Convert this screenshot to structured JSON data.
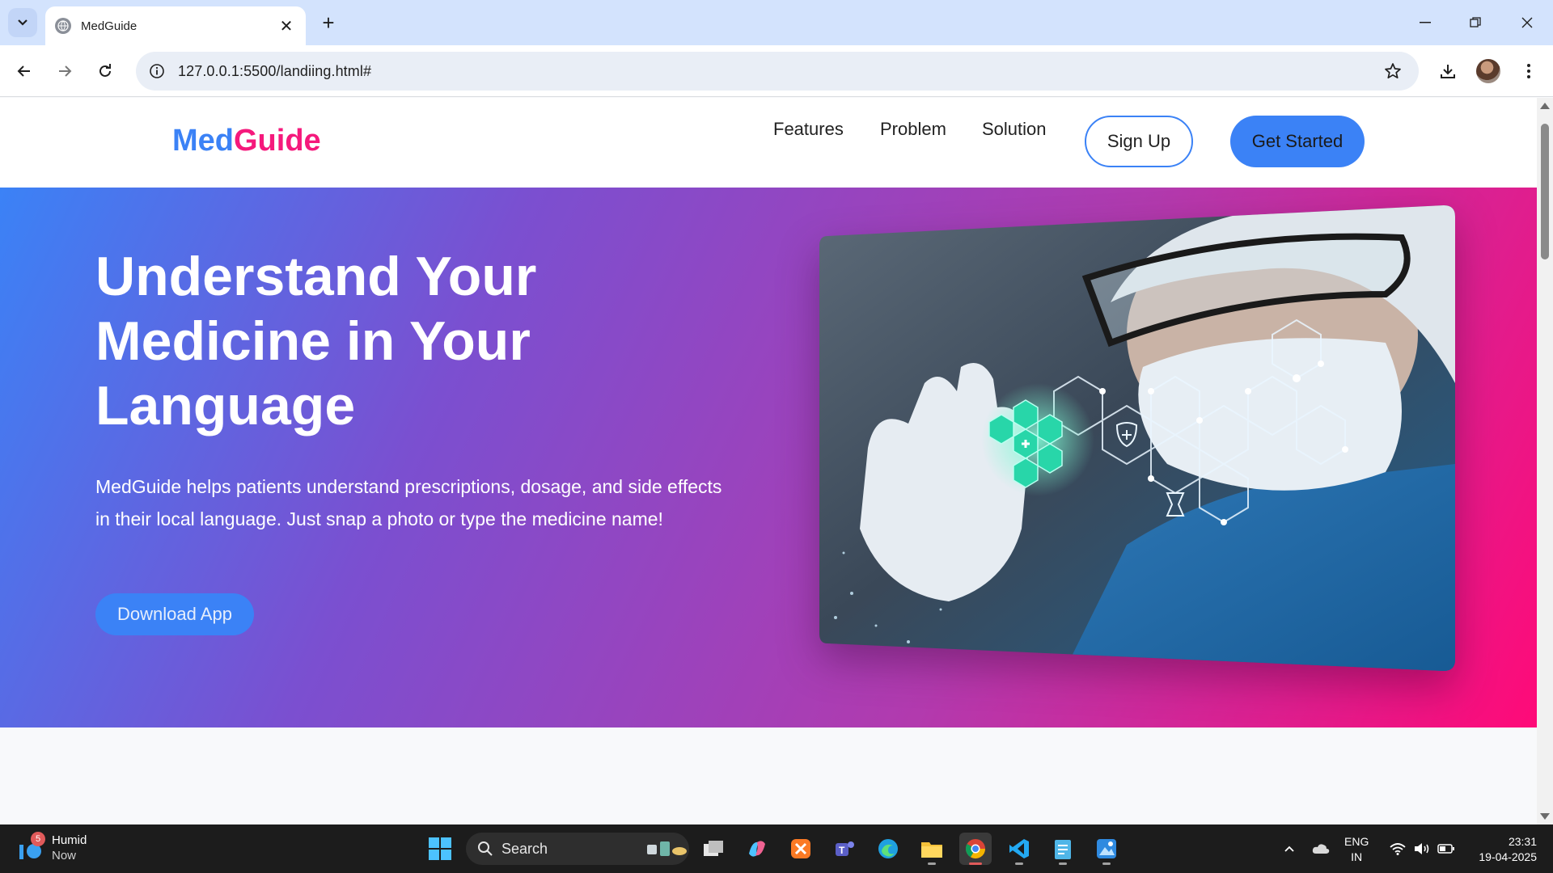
{
  "browser": {
    "tab_title": "MedGuide",
    "url": "127.0.0.1:5500/landiing.html#"
  },
  "site": {
    "logo_part1": "Med",
    "logo_part2": "Guide",
    "nav": [
      "Features",
      "Problem",
      "Solution"
    ],
    "signup_label": "Sign Up",
    "get_started_label": "Get Started"
  },
  "hero": {
    "title": "Understand Your Medicine in Your Language",
    "description": "MedGuide helps patients understand prescriptions, dosage, and side effects in their local language. Just snap a photo or type the medicine name!",
    "download_label": "Download App"
  },
  "taskbar": {
    "weather_title": "Humid",
    "weather_sub": "Now",
    "weather_badge": "5",
    "search_label": "Search",
    "lang_line1": "ENG",
    "lang_line2": "IN",
    "time": "23:31",
    "date": "19-04-2025"
  },
  "colors": {
    "brand_blue": "#3b82f6",
    "brand_pink": "#f5197c",
    "hero_gradient": [
      "#3b82f6",
      "#7b4fd0",
      "#b23aae",
      "#ff0a78"
    ]
  }
}
